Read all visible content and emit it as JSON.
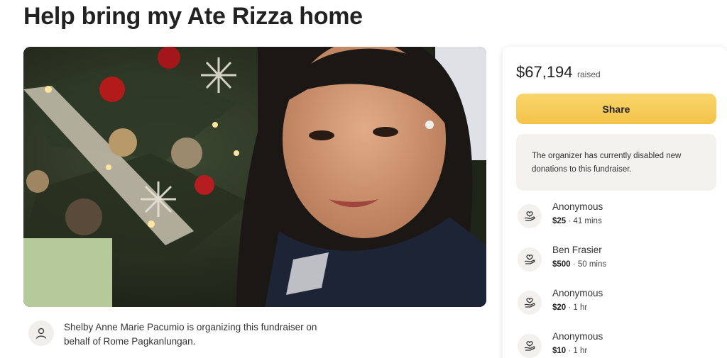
{
  "page": {
    "title": "Help bring my Ate Rizza home"
  },
  "organizer": {
    "text": "Shelby Anne Marie Pacumio is organizing this fundraiser on behalf of Rome Pagkanlungan.",
    "icon": "user-icon"
  },
  "sidebar": {
    "raised_amount": "$67,194",
    "raised_label": "raised",
    "share_label": "Share",
    "notice": "The organizer has currently disabled new donations to this fundraiser.",
    "donations": [
      {
        "name": "Anonymous",
        "amount": "$25",
        "time": "41 mins"
      },
      {
        "name": "Ben Frasier",
        "amount": "$500",
        "time": "50 mins"
      },
      {
        "name": "Anonymous",
        "amount": "$20",
        "time": "1 hr"
      },
      {
        "name": "Anonymous",
        "amount": "$10",
        "time": "1 hr"
      }
    ]
  },
  "colors": {
    "share_button": "#f5c84f",
    "notice_bg": "#f4f2ee"
  }
}
